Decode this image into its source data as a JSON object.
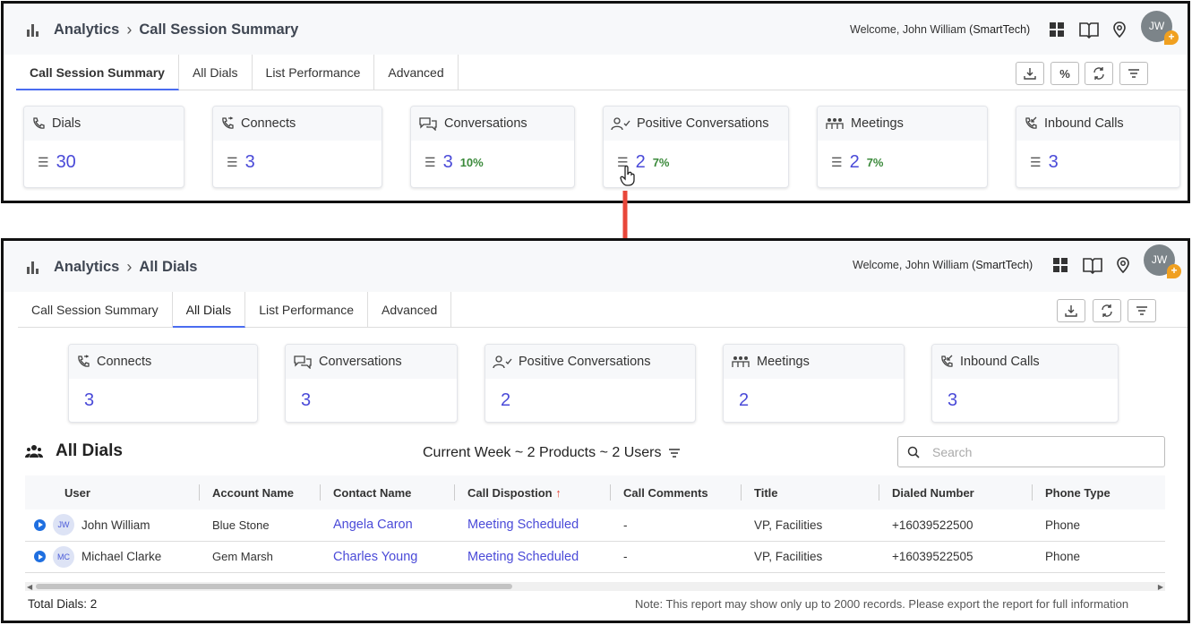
{
  "top": {
    "breadcrumb": {
      "root": "Analytics",
      "current": "Call Session Summary"
    },
    "user": {
      "welcome": "Welcome, John William",
      "org": "(SmartTech)",
      "initials": "JW"
    },
    "tabs": [
      "Call Session Summary",
      "All Dials",
      "List Performance",
      "Advanced"
    ],
    "active_tab": "Call Session Summary",
    "cards": [
      {
        "title": "Dials",
        "value": "30",
        "pct": ""
      },
      {
        "title": "Connects",
        "value": "3",
        "pct": ""
      },
      {
        "title": "Conversations",
        "value": "3",
        "pct": "10%"
      },
      {
        "title": "Positive Conversations",
        "value": "2",
        "pct": "7%"
      },
      {
        "title": "Meetings",
        "value": "2",
        "pct": "7%"
      },
      {
        "title": "Inbound Calls",
        "value": "3",
        "pct": ""
      }
    ]
  },
  "bottom": {
    "breadcrumb": {
      "root": "Analytics",
      "current": "All Dials"
    },
    "user": {
      "welcome": "Welcome, John William",
      "org": "(SmartTech)",
      "initials": "JW"
    },
    "tabs": [
      "Call Session Summary",
      "All Dials",
      "List Performance",
      "Advanced"
    ],
    "active_tab": "All Dials",
    "cards": [
      {
        "title": "Connects",
        "value": "3"
      },
      {
        "title": "Conversations",
        "value": "3"
      },
      {
        "title": "Positive Conversations",
        "value": "2"
      },
      {
        "title": "Meetings",
        "value": "2"
      },
      {
        "title": "Inbound Calls",
        "value": "3"
      }
    ],
    "section_title": "All Dials",
    "filter_text": "Current Week ~ 2 Products ~ 2 Users",
    "search_placeholder": "Search",
    "columns": [
      "User",
      "Account Name",
      "Contact Name",
      "Call Dispostion",
      "Call Comments",
      "Title",
      "Dialed Number",
      "Phone Type"
    ],
    "rows": [
      {
        "initials": "JW",
        "user": "John William",
        "account": "Blue Stone",
        "contact": "Angela Caron",
        "disposition": "Meeting Scheduled",
        "comments": "-",
        "title": "VP, Facilities",
        "number": "+16039522500",
        "phone_type": "Phone"
      },
      {
        "initials": "MC",
        "user": "Michael Clarke",
        "account": "Gem Marsh",
        "contact": "Charles Young",
        "disposition": "Meeting Scheduled",
        "comments": "-",
        "title": "VP, Facilities",
        "number": "+16039522505",
        "phone_type": "Phone"
      }
    ],
    "total": "Total Dials: 2",
    "note": "Note: This report may show only up to 2000 records. Please export the report for full information"
  },
  "colors": {
    "accent": "#4a4ad8",
    "positive": "#3b8a3b",
    "arrow": "#e8473a",
    "badge": "#f0a020"
  }
}
